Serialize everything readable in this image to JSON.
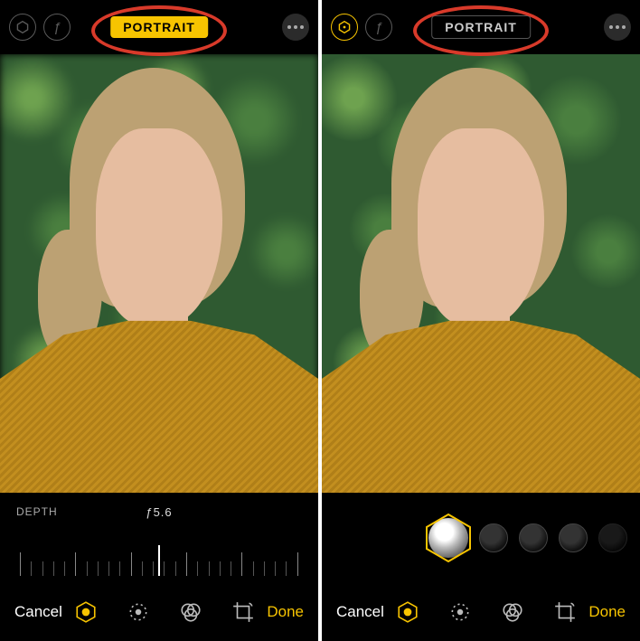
{
  "left": {
    "mode_label": "PORTRAIT",
    "mode_on": true,
    "depth_label": "DEPTH",
    "depth_value": "ƒ5.6",
    "cancel": "Cancel",
    "done": "Done",
    "active_tool": "portrait-lighting"
  },
  "right": {
    "mode_label": "PORTRAIT",
    "mode_on": false,
    "cancel": "Cancel",
    "done": "Done",
    "active_tool": "portrait-lighting",
    "lighting_options": [
      "natural",
      "studio",
      "contour",
      "stage",
      "stage-mono"
    ],
    "lighting_selected": "natural"
  },
  "icons": {
    "aperture": "ƒ"
  }
}
